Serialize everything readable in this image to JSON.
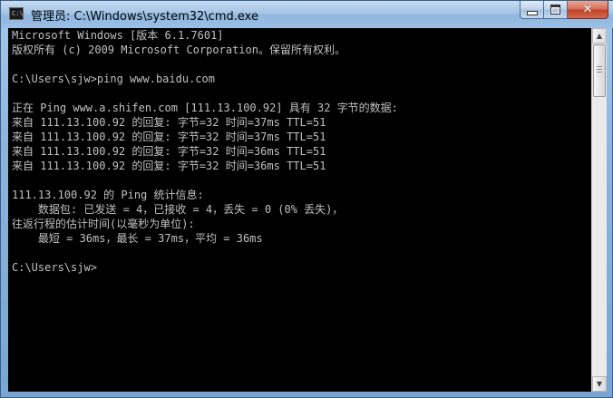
{
  "window": {
    "title": "管理员: C:\\Windows\\system32\\cmd.exe",
    "icon": "cmd-icon",
    "icon_glyph": "C:\\"
  },
  "caption_buttons": {
    "minimize": "minimize-icon",
    "maximize": "maximize-icon",
    "close_glyph": "✕"
  },
  "scrollbar": {
    "up_glyph": "▲",
    "down_glyph": "▼"
  },
  "console": {
    "lines": [
      "Microsoft Windows [版本 6.1.7601]",
      "版权所有 (c) 2009 Microsoft Corporation。保留所有权利。",
      "",
      "C:\\Users\\sjw>ping www.baidu.com",
      "",
      "正在 Ping www.a.shifen.com [111.13.100.92] 具有 32 字节的数据:",
      "来自 111.13.100.92 的回复: 字节=32 时间=37ms TTL=51",
      "来自 111.13.100.92 的回复: 字节=32 时间=37ms TTL=51",
      "来自 111.13.100.92 的回复: 字节=32 时间=36ms TTL=51",
      "来自 111.13.100.92 的回复: 字节=32 时间=36ms TTL=51",
      "",
      "111.13.100.92 的 Ping 统计信息:",
      "    数据包: 已发送 = 4，已接收 = 4，丢失 = 0 (0% 丢失)，",
      "往返行程的估计时间(以毫秒为单位):",
      "    最短 = 36ms，最长 = 37ms，平均 = 36ms",
      "",
      "C:\\Users\\sjw>"
    ]
  }
}
